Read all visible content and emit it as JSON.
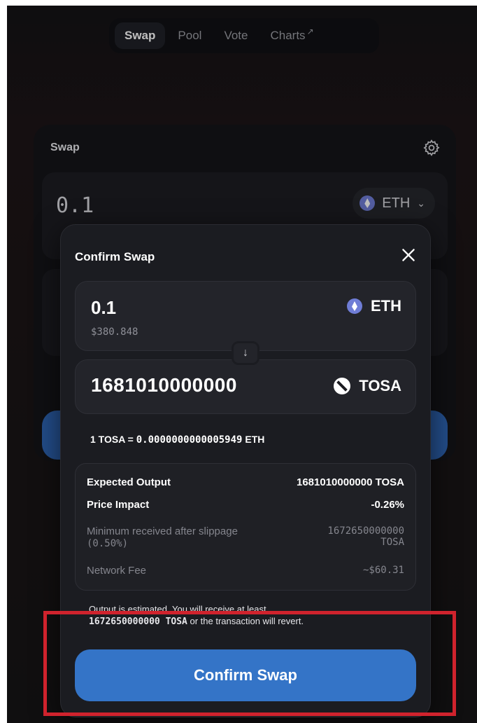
{
  "nav": {
    "items": [
      {
        "label": "Swap",
        "active": true
      },
      {
        "label": "Pool",
        "active": false
      },
      {
        "label": "Vote",
        "active": false
      },
      {
        "label": "Charts",
        "external": true
      }
    ],
    "external_glyph": "↗"
  },
  "swap_card": {
    "title": "Swap",
    "settings_icon": "gear-icon",
    "input_amount": "0.1",
    "input_token": "ETH"
  },
  "modal": {
    "title": "Confirm Swap",
    "close_icon": "close-icon",
    "input": {
      "amount": "0.1",
      "usd": "$380.848",
      "token": "ETH"
    },
    "output": {
      "amount": "1681010000000",
      "token": "TOSA"
    },
    "direction_icon": "↓",
    "rate_prefix": "1 TOSA = ",
    "rate_value": "0.0000000000005949",
    "rate_suffix": " ETH",
    "details": {
      "expected_output_label": "Expected Output",
      "expected_output_value": "1681010000000 TOSA",
      "price_impact_label": "Price Impact",
      "price_impact_value": "-0.26%",
      "min_received_label_1": "Minimum received after slippage",
      "min_received_label_2": "(0.50%)",
      "min_received_value_1": "1672650000000",
      "min_received_value_2": "TOSA",
      "network_fee_label": "Network Fee",
      "network_fee_value": "~$60.31"
    },
    "note_1": "Output is estimated. You will receive at least",
    "note_amount": "1672650000000 TOSA",
    "note_2": " or the transaction will revert.",
    "confirm_label": "Confirm Swap"
  },
  "colors": {
    "primary_button": "#3474c7",
    "highlight_box": "#d0232d",
    "eth_icon": "#6f7dd6"
  }
}
